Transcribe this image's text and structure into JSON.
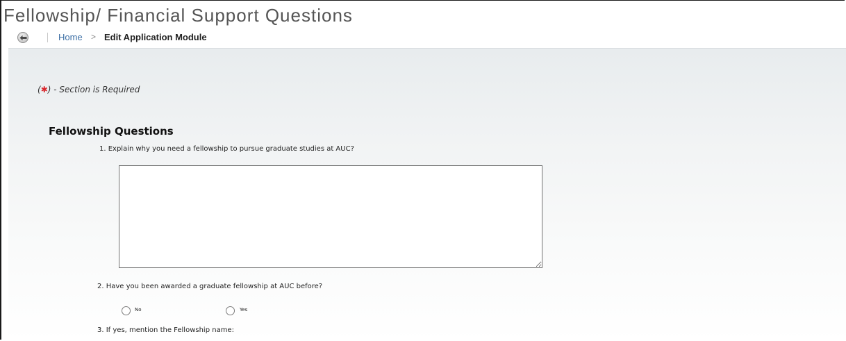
{
  "header": {
    "title": "Fellowship/ Financial Support Questions"
  },
  "breadcrumb": {
    "back_icon": "back-arrow-icon",
    "home": "Home",
    "separator": ">",
    "current": "Edit Application Module"
  },
  "form": {
    "required_note_prefix": "(",
    "required_note_star": "✱",
    "required_note_suffix": ") - Section is Required",
    "section_heading": "Fellowship Questions",
    "questions": [
      {
        "text": "1. Explain why you need a fellowship to pursue graduate studies at AUC?",
        "value": ""
      },
      {
        "text": "2. Have you been awarded a graduate fellowship at AUC before?",
        "options": [
          "No",
          "Yes"
        ],
        "selected": null
      },
      {
        "text": "3. If yes, mention the Fellowship name:"
      }
    ]
  },
  "colors": {
    "title": "#555555",
    "link": "#3b6ea5",
    "required_star": "#d9262c"
  }
}
